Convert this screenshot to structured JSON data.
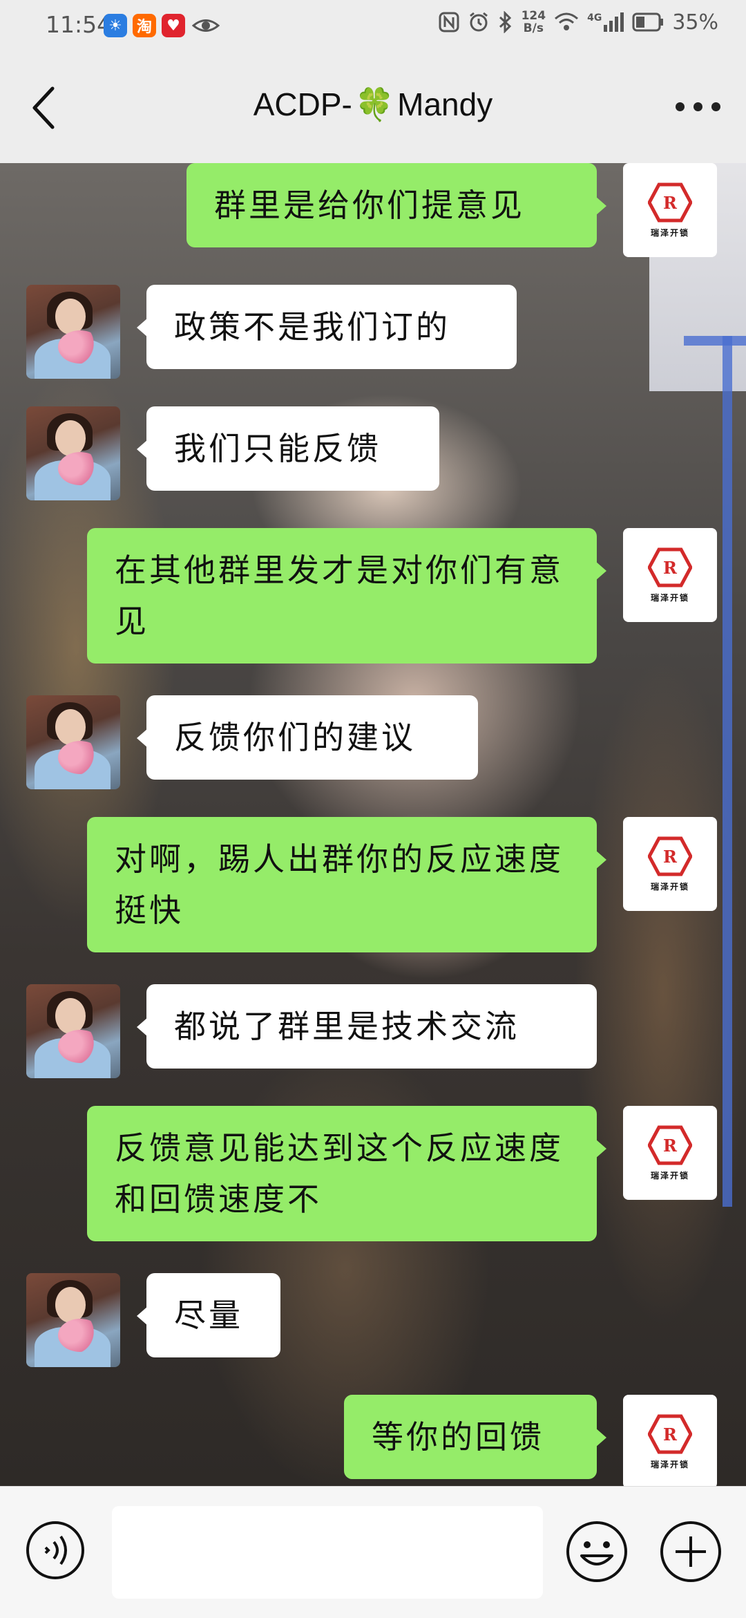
{
  "status_bar": {
    "time": "11:54",
    "net_speed_value": "124",
    "net_speed_unit": "B/s",
    "signal_label": "4G",
    "battery": "35%",
    "app_icons": [
      "weather-app-icon",
      "taobao-app-icon",
      "heart-app-icon",
      "eye-icon"
    ]
  },
  "header": {
    "title_prefix": "ACDP-",
    "title_emoji": "🍀",
    "title_suffix": "Mandy"
  },
  "self_avatar_text": "瑞泽开锁",
  "messages": [
    {
      "side": "me",
      "text": "群里是给你们提意见"
    },
    {
      "side": "other",
      "text": "政策不是我们订的"
    },
    {
      "side": "other",
      "text": "我们只能反馈"
    },
    {
      "side": "me",
      "text": "在其他群里发才是对你们有意见"
    },
    {
      "side": "other",
      "text": "反馈你们的建议"
    },
    {
      "side": "me",
      "text": "对啊，踢人出群你的反应速度挺快"
    },
    {
      "side": "other",
      "text": "都说了群里是技术交流"
    },
    {
      "side": "me",
      "text": "反馈意见能达到这个反应速度和回馈速度不"
    },
    {
      "side": "other",
      "text": "尽量"
    },
    {
      "side": "me",
      "text": "等你的回馈"
    }
  ],
  "input": {
    "placeholder": "",
    "value": ""
  },
  "colors": {
    "self_bubble": "#95ec69",
    "other_bubble": "#ffffff",
    "bar_bg": "#ededed"
  }
}
